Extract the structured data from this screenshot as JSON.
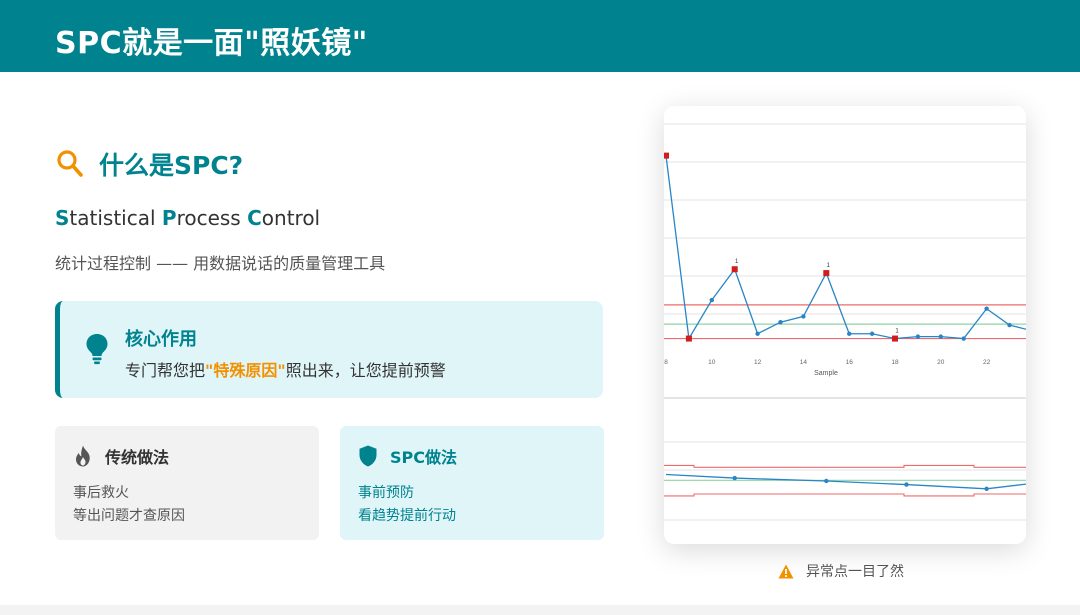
{
  "header": {
    "title": "SPC就是一面\"照妖镜\""
  },
  "what_is": {
    "icon": "search-icon",
    "title": "什么是SPC?",
    "full_name": [
      {
        "cap": "S",
        "rest": "tatistical "
      },
      {
        "cap": "P",
        "rest": "rocess "
      },
      {
        "cap": "C",
        "rest": "ontrol"
      }
    ],
    "description": "统计过程控制 —— 用数据说话的质量管理工具"
  },
  "core": {
    "icon": "lightbulb-icon",
    "title": "核心作用",
    "text_before": "专门帮您把",
    "highlight": "\"特殊原因\"",
    "text_after": "照出来，让您提前预警"
  },
  "compare": {
    "traditional": {
      "icon": "fire-icon",
      "title": "传统做法",
      "line1": "事后救火",
      "line2": "等出问题才查原因"
    },
    "spc": {
      "icon": "shield-icon",
      "title": "SPC做法",
      "line1": "事前预防",
      "line2": "看趋势提前行动"
    }
  },
  "chart_data": {
    "type": "line",
    "xlabel": "Sample",
    "xticks": [
      "8",
      "10",
      "12",
      "14",
      "16",
      "18",
      "20",
      "22"
    ],
    "top_series": [
      {
        "x": 8,
        "y": 26.0,
        "alarm": true
      },
      {
        "x": 9,
        "y": 7.0,
        "alarm": true
      },
      {
        "x": 10,
        "y": 11.0,
        "alarm": false
      },
      {
        "x": 11,
        "y": 14.2,
        "alarm": true
      },
      {
        "x": 12,
        "y": 7.5,
        "alarm": false
      },
      {
        "x": 13,
        "y": 8.7,
        "alarm": false
      },
      {
        "x": 14,
        "y": 9.3,
        "alarm": false
      },
      {
        "x": 15,
        "y": 13.8,
        "alarm": true
      },
      {
        "x": 16,
        "y": 7.5,
        "alarm": false
      },
      {
        "x": 17,
        "y": 7.5,
        "alarm": false
      },
      {
        "x": 18,
        "y": 7.0,
        "alarm": true
      },
      {
        "x": 19,
        "y": 7.2,
        "alarm": false
      },
      {
        "x": 20,
        "y": 7.2,
        "alarm": false
      },
      {
        "x": 21,
        "y": 7.0,
        "alarm": false
      },
      {
        "x": 22,
        "y": 10.1,
        "alarm": false
      },
      {
        "x": 23,
        "y": 8.4,
        "alarm": false
      },
      {
        "x": 24,
        "y": 7.8,
        "alarm": false
      }
    ],
    "alarm_labels": [
      "1",
      "1",
      "1"
    ],
    "top_limits": {
      "ucl": 10.5,
      "center": 8.5,
      "lcl": 7.0
    },
    "top_ylim": [
      5.5,
      27
    ],
    "bottom_series": [
      {
        "x": 8,
        "y": 1.0
      },
      {
        "x": 11,
        "y": 0.45
      },
      {
        "x": 15,
        "y": 0.0
      },
      {
        "x": 18.5,
        "y": -0.55
      },
      {
        "x": 22,
        "y": -1.2
      },
      {
        "x": 25,
        "y": 0.05
      },
      {
        "x": 26,
        "y": 0.0
      }
    ],
    "bottom_ylim": [
      -6,
      6
    ],
    "colors": {
      "series": "#2a85c6",
      "alarm": "#d01c1c",
      "limit": "#ee6b6b",
      "center": "#8fd3a6",
      "grid": "#e3e3e3"
    }
  },
  "caption": {
    "icon": "warning-icon",
    "text": "异常点一目了然"
  },
  "colors": {
    "primary": "#00838f",
    "accent": "#f29100",
    "card_tint": "#e0f5f8"
  }
}
